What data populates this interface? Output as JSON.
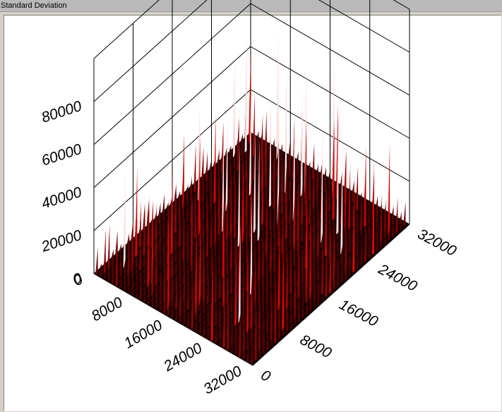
{
  "window": {
    "title": "Standard Deviation"
  },
  "chart_data": {
    "type": "surface",
    "title": "",
    "xlabel": "",
    "ylabel": "",
    "zlabel": "",
    "x_ticks": [
      "0",
      "8000",
      "16000",
      "24000",
      "32000"
    ],
    "y_ticks": [
      "0",
      "8000",
      "16000",
      "24000",
      "32000"
    ],
    "z_ticks": [
      "0",
      "20000",
      "40000",
      "60000",
      "80000"
    ],
    "xlim": [
      0,
      32000
    ],
    "ylim": [
      0,
      32000
    ],
    "zlim": [
      0,
      100000
    ],
    "grid": true,
    "colormap": [
      "#000000",
      "#ff0000",
      "#ffffff"
    ],
    "surface_description": "noisy spiky surface; baseline near 5000, isolated peaks up to ~85000, taller peaks along the far-right region"
  }
}
